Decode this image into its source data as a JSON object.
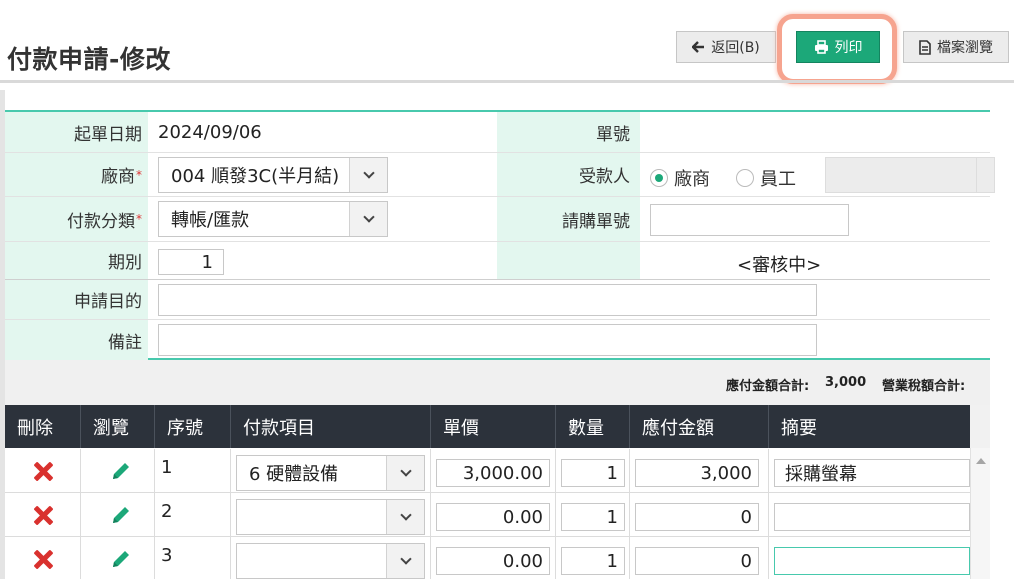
{
  "page": {
    "title": "付款申請-修改"
  },
  "toolbar": {
    "back_label": "返回(B)",
    "print_label": "列印",
    "file_label": "檔案瀏覽"
  },
  "form": {
    "start_date_label": "起單日期",
    "start_date_value": "2024/09/06",
    "doc_no_label": "單號",
    "doc_no_value": "",
    "vendor_label": "廠商",
    "vendor_value": "004 順發3C(半月結)",
    "payee_label": "受款人",
    "payee_option_vendor": "廠商",
    "payee_option_employee": "員工",
    "payee_selected": "廠商",
    "category_label": "付款分類",
    "category_value": "轉帳/匯款",
    "purchase_no_label": "請購單號",
    "purchase_no_value": "",
    "period_label": "期別",
    "period_value": "1",
    "status_text": "<審核中>",
    "purpose_label": "申請目的",
    "purpose_value": "",
    "remark_label": "備註",
    "remark_value": "",
    "required_mark": "*"
  },
  "totals": {
    "payable_label": "應付金額合計:",
    "payable_value": "3,000",
    "tax_label": "營業稅額合計:",
    "tax_value": ""
  },
  "grid": {
    "columns": [
      "刪除",
      "瀏覽",
      "序號",
      "付款項目",
      "單價",
      "數量",
      "應付金額",
      "摘要"
    ],
    "rows": [
      {
        "seq": "1",
        "item": "6 硬體設備",
        "price": "3,000.00",
        "qty": "1",
        "amount": "3,000",
        "summary": "採購螢幕"
      },
      {
        "seq": "2",
        "item": "",
        "price": "0.00",
        "qty": "1",
        "amount": "0",
        "summary": ""
      },
      {
        "seq": "3",
        "item": "",
        "price": "0.00",
        "qty": "1",
        "amount": "0",
        "summary": ""
      }
    ]
  },
  "colors": {
    "accent": "#1ca879",
    "label_bg": "#e3f7ef",
    "header_bg": "#2c323b",
    "delete_icon": "#d9312e",
    "highlight_ring": "#f6a48f"
  },
  "icons": {
    "back": "arrow-left-icon",
    "print": "printer-icon",
    "file": "file-icon",
    "delete": "close-icon",
    "browse": "pencil-icon",
    "dropdown": "chevron-down-icon"
  }
}
